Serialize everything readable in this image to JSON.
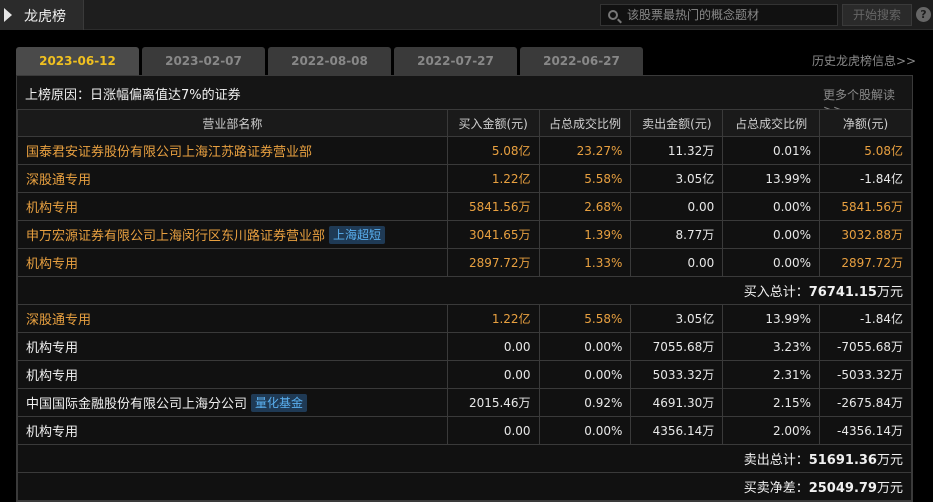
{
  "header": {
    "title": "龙虎榜",
    "search_placeholder": "该股票最热门的概念题材",
    "search_button": "开始搜索",
    "help": "?"
  },
  "tabs": [
    "2023-06-12",
    "2023-02-07",
    "2022-08-08",
    "2022-07-27",
    "2022-06-27"
  ],
  "active_tab": 0,
  "history_link": "历史龙虎榜信息>>",
  "reason": "上榜原因：日涨幅偏离值达7%的证券",
  "more_link": "更多个股解读>>",
  "columns": [
    "营业部名称",
    "买入金额(元)",
    "占总成交比例",
    "卖出金额(元)",
    "占总成交比例",
    "净额(元)"
  ],
  "buy_rows": [
    {
      "name": "国泰君安证券股份有限公司上海江苏路证券营业部",
      "tag": "",
      "buy": "5.08亿",
      "buy_pct": "23.27%",
      "sell": "11.32万",
      "sell_pct": "0.01%",
      "net": "5.08亿"
    },
    {
      "name": "深股通专用",
      "tag": "",
      "buy": "1.22亿",
      "buy_pct": "5.58%",
      "sell": "3.05亿",
      "sell_pct": "13.99%",
      "net": "-1.84亿"
    },
    {
      "name": "机构专用",
      "tag": "",
      "buy": "5841.56万",
      "buy_pct": "2.68%",
      "sell": "0.00",
      "sell_pct": "0.00%",
      "net": "5841.56万"
    },
    {
      "name": "申万宏源证券有限公司上海闵行区东川路证券营业部",
      "tag": "上海超短",
      "buy": "3041.65万",
      "buy_pct": "1.39%",
      "sell": "8.77万",
      "sell_pct": "0.00%",
      "net": "3032.88万"
    },
    {
      "name": "机构专用",
      "tag": "",
      "buy": "2897.72万",
      "buy_pct": "1.33%",
      "sell": "0.00",
      "sell_pct": "0.00%",
      "net": "2897.72万"
    }
  ],
  "buy_total_label": "买入总计：",
  "buy_total_value": "76741.15",
  "buy_total_unit": "万元",
  "sell_rows": [
    {
      "name": "深股通专用",
      "tag": "",
      "buy": "1.22亿",
      "buy_pct": "5.58%",
      "sell": "3.05亿",
      "sell_pct": "13.99%",
      "net": "-1.84亿"
    },
    {
      "name": "机构专用",
      "tag": "",
      "buy": "0.00",
      "buy_pct": "0.00%",
      "sell": "7055.68万",
      "sell_pct": "3.23%",
      "net": "-7055.68万"
    },
    {
      "name": "机构专用",
      "tag": "",
      "buy": "0.00",
      "buy_pct": "0.00%",
      "sell": "5033.32万",
      "sell_pct": "2.31%",
      "net": "-5033.32万"
    },
    {
      "name": "中国国际金融股份有限公司上海分公司",
      "tag": "量化基金",
      "buy": "2015.46万",
      "buy_pct": "0.92%",
      "sell": "4691.30万",
      "sell_pct": "2.15%",
      "net": "-2675.84万"
    },
    {
      "name": "机构专用",
      "tag": "",
      "buy": "0.00",
      "buy_pct": "0.00%",
      "sell": "4356.14万",
      "sell_pct": "2.00%",
      "net": "-4356.14万"
    }
  ],
  "sell_total_label": "卖出总计：",
  "sell_total_value": "51691.36",
  "sell_total_unit": "万元",
  "net_total_label": "买卖净差：",
  "net_total_value": "25049.79",
  "net_total_unit": "万元",
  "colors": {
    "accent": "#f0c020",
    "buy_highlight": "#e8a040",
    "tag_bg": "#1f3a55",
    "tag_text": "#5ab0f0"
  }
}
